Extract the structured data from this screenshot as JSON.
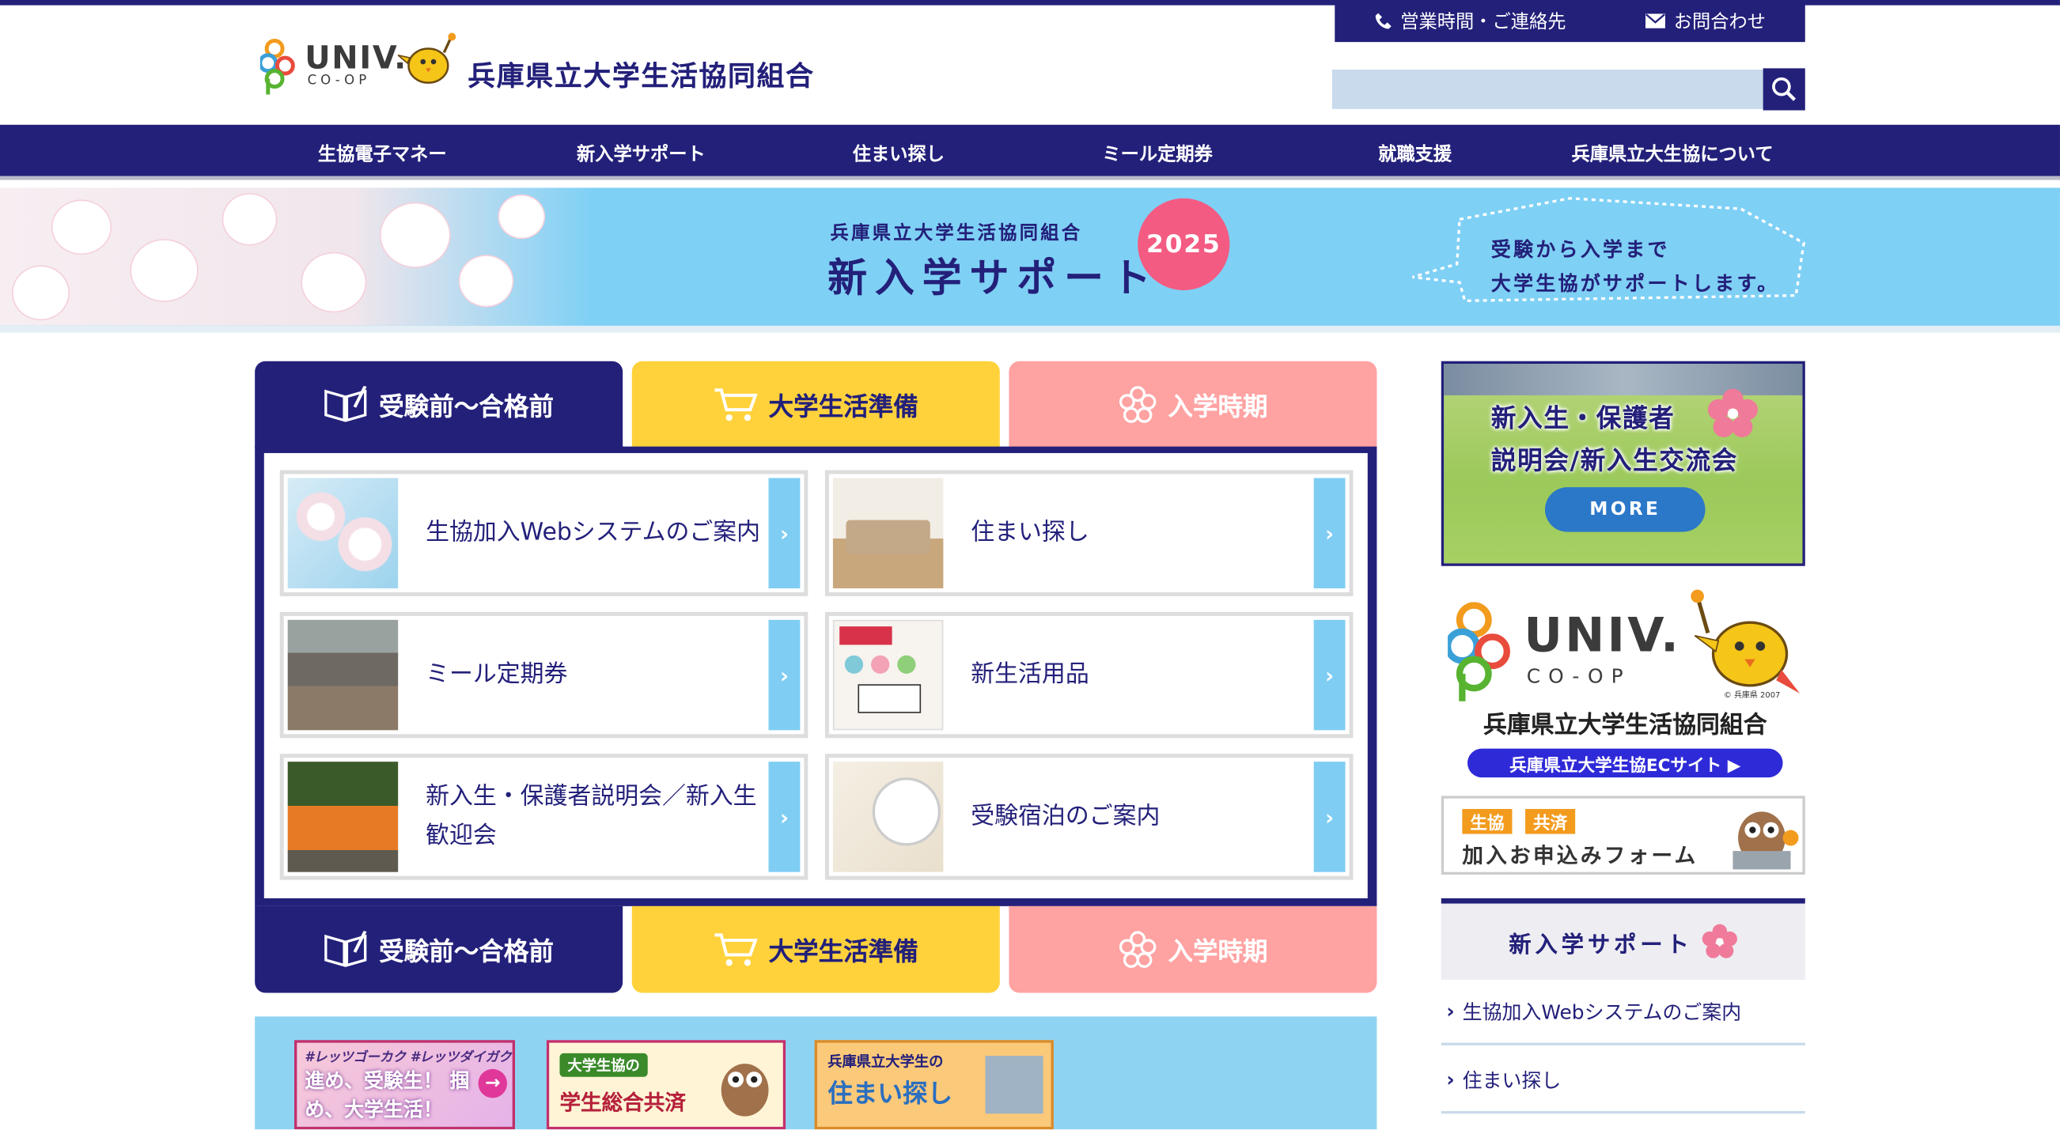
{
  "header": {
    "logo_univ": "UNIV.",
    "logo_coop": "CO-OP",
    "org_name": "兵庫県立大学生活協同組合",
    "util_hours": "営業時間・ご連絡先",
    "util_contact": "お問合わせ",
    "search_placeholder": ""
  },
  "gnav": {
    "items": [
      "生協電子マネー",
      "新入学サポート",
      "住まい探し",
      "ミール定期券",
      "就職支援",
      "兵庫県立大生協について"
    ]
  },
  "hero": {
    "sub": "兵庫県立大学生活協同組合",
    "main": "新入学サポート",
    "year": "2025",
    "bubble_line1": "受験から入学まで",
    "bubble_line2": "大学生協がサポートします。"
  },
  "tabs": {
    "t1": "受験前～合格前",
    "t2": "大学生活準備",
    "t3": "入学時期"
  },
  "cards": [
    {
      "label": "生協加入Webシステムのご案内",
      "thumb": "cherry-blossom"
    },
    {
      "label": "住まい探し",
      "thumb": "sofa-room"
    },
    {
      "label": "ミール定期券",
      "thumb": "cafeteria"
    },
    {
      "label": "新生活用品",
      "thumb": "debut-leaflet"
    },
    {
      "label": "新入生・保護者説明会／新入生歓迎会",
      "thumb": "orange-group"
    },
    {
      "label": "受験宿泊のご案内",
      "thumb": "alarm-clock"
    }
  ],
  "banners": {
    "b1_top": "#レッツゴーカク #レッツダイガク",
    "b1_main": "進め、受験生！ 掴め、大学生活！",
    "b2_top": "大学生協の",
    "b2_main": "学生総合共済",
    "b3_top": "兵庫県立大学生の",
    "b3_main": "住まい探し"
  },
  "sidebar": {
    "event_line1": "新入生・保護者",
    "event_line2": "説明会/新入生交流会",
    "event_more": "MORE",
    "univ_text": "UNIV.",
    "coop_text": "CO-OP",
    "univ_small": "© 兵庫県 2007",
    "univ_org": "兵庫県立大学生活協同組合",
    "ec_label": "兵庫県立大学生協ECサイト ▶",
    "join_tag1": "生協",
    "join_tag2": "共済",
    "join_main": "加入お申込みフォーム",
    "nav_head": "新入学サポート",
    "links": [
      "生協加入Webシステムのご案内",
      "住まい探し"
    ]
  },
  "colors": {
    "navy": "#23207a",
    "yellow": "#ffd23c",
    "pink": "#ffa2a2",
    "sky": "#7fd0f5"
  }
}
